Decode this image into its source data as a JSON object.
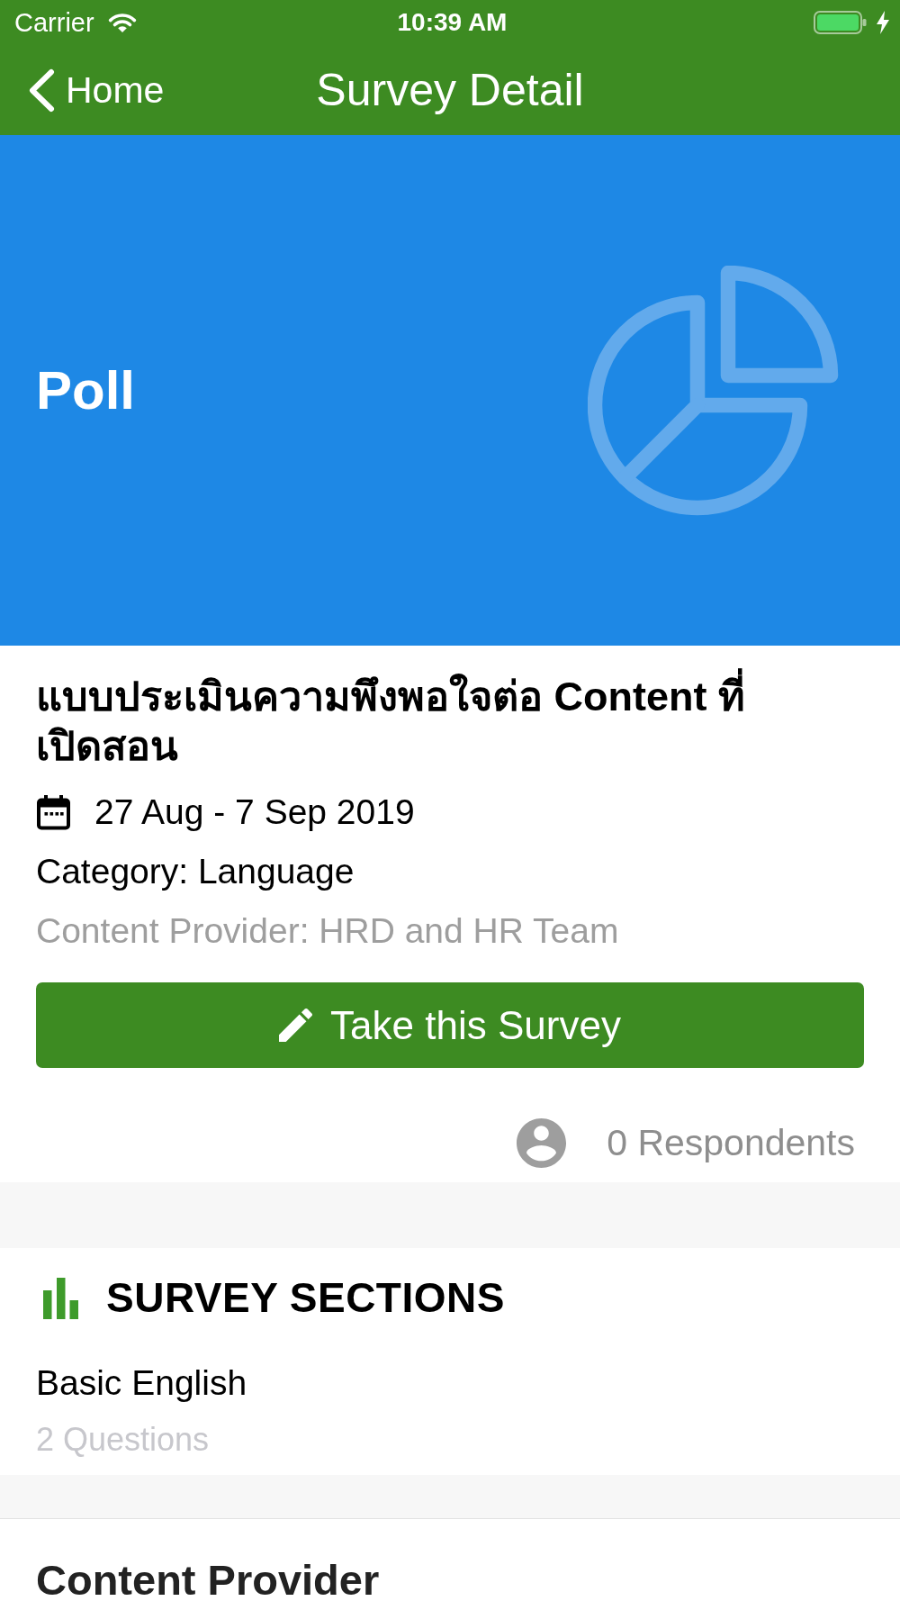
{
  "status_bar": {
    "carrier": "Carrier",
    "time": "10:39 AM"
  },
  "nav_bar": {
    "back_label": "Home",
    "title": "Survey Detail"
  },
  "banner": {
    "label": "Poll"
  },
  "survey": {
    "title": "แบบประเมินความพึงพอใจต่อ Content ที่เปิดสอน",
    "date_range": "27 Aug - 7 Sep 2019",
    "category": "Category: Language",
    "provider": "Content Provider: HRD and HR Team",
    "action_button": "Take this Survey",
    "respondents": "0 Respondents"
  },
  "sections_card": {
    "heading": "SURVEY SECTIONS",
    "sections": [
      {
        "name": "Basic English",
        "questions": "2 Questions"
      }
    ]
  },
  "provider_card": {
    "heading": "Content Provider"
  }
}
